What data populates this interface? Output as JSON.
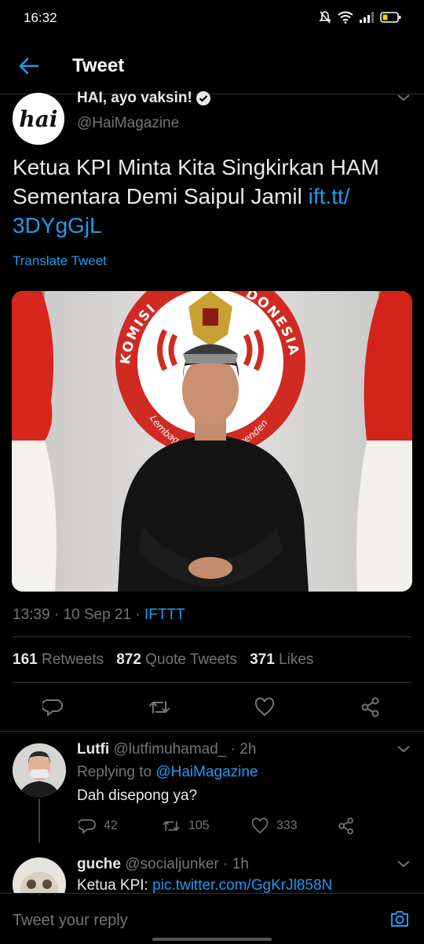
{
  "status_bar": {
    "time": "16:32"
  },
  "header": {
    "title": "Tweet"
  },
  "tweet": {
    "author_name": "HAI, ayo vaksin!",
    "author_handle": "@HaiMagazine",
    "avatar_text": "hai",
    "text_main": "Ketua KPI Minta Kita Singkirkan HAM Sementara Demi Saipul Jamil ",
    "text_link": "ift.tt/ 3DYgGjL",
    "translate_label": "Translate Tweet",
    "photo_banner_left": "KOMISI",
    "photo_banner_right": "DONESIA",
    "photo_banner_bottom": "Lembaga Negara Independen",
    "time": "13:39",
    "date": "10 Sep 21",
    "source": "IFTTT",
    "retweets_count": "161",
    "retweets_label": "Retweets",
    "quotes_count": "872",
    "quotes_label": "Quote Tweets",
    "likes_count": "371",
    "likes_label": "Likes"
  },
  "replies": [
    {
      "name": "Lutfi",
      "handle": "@lutfimuhamad_",
      "time": "· 2h",
      "replying_prefix": "Replying to ",
      "replying_to": "@HaiMagazine",
      "text": "Dah disepong ya?",
      "reply_count": "42",
      "retweet_count": "105",
      "like_count": "333"
    },
    {
      "name": "guche",
      "handle": "@socialjunker",
      "time": "· 1h",
      "text_prefix": "Ketua KPI: ",
      "text_link": "pic.twitter.com/GgKrJl858N"
    }
  ],
  "compose": {
    "placeholder": "Tweet your reply"
  },
  "colors": {
    "accent": "#1d9bf0",
    "background": "#000000",
    "muted": "#71767b"
  }
}
